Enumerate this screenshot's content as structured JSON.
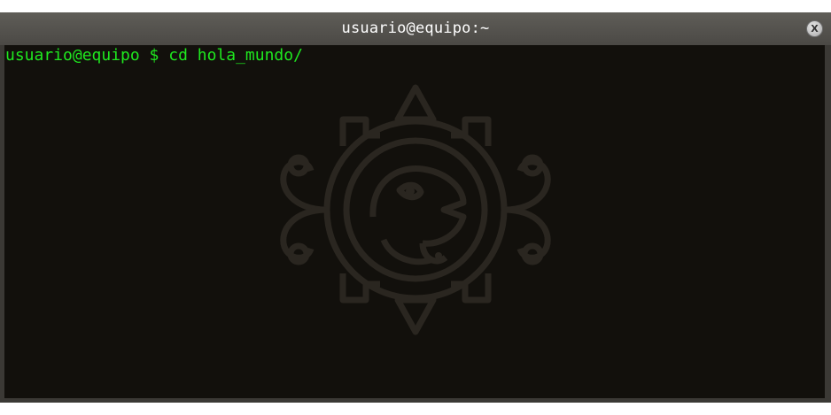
{
  "window": {
    "title": "usuario@equipo:~",
    "close_label": "X"
  },
  "terminal": {
    "prompt": "usuario@equipo $ cd hola_mundo/"
  },
  "colors": {
    "terminal_bg": "#12100c",
    "prompt_text": "#1fe81f",
    "titlebar": "#55534e",
    "watermark": "#2a2620"
  },
  "icons": {
    "close": "close-icon",
    "background": "aztec-sun-stone-watermark"
  }
}
